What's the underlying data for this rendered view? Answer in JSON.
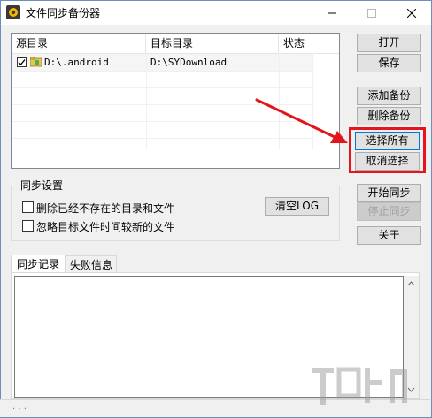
{
  "window": {
    "title": "文件同步备份器"
  },
  "listview": {
    "columns": [
      "源目录",
      "目标目录",
      "状态"
    ],
    "rows": [
      {
        "source": "D:\\.android",
        "target": "D:\\SYDownload",
        "status": "",
        "checked": true
      }
    ]
  },
  "buttons": {
    "open": "打开",
    "save": "保存",
    "add_backup": "添加备份",
    "delete_backup": "删除备份",
    "select_all": "选择所有",
    "cancel_select": "取消选择",
    "start_sync": "开始同步",
    "stop_sync": "停止同步",
    "about": "关于",
    "clear_log": "清空LOG"
  },
  "sync_settings": {
    "title": "同步设置",
    "delete_nonexistent": "删除已经不存在的目录和文件",
    "ignore_newer": "忽略目标文件时间较新的文件"
  },
  "tabs": [
    "同步记录",
    "失败信息"
  ],
  "status_text": ". . ."
}
